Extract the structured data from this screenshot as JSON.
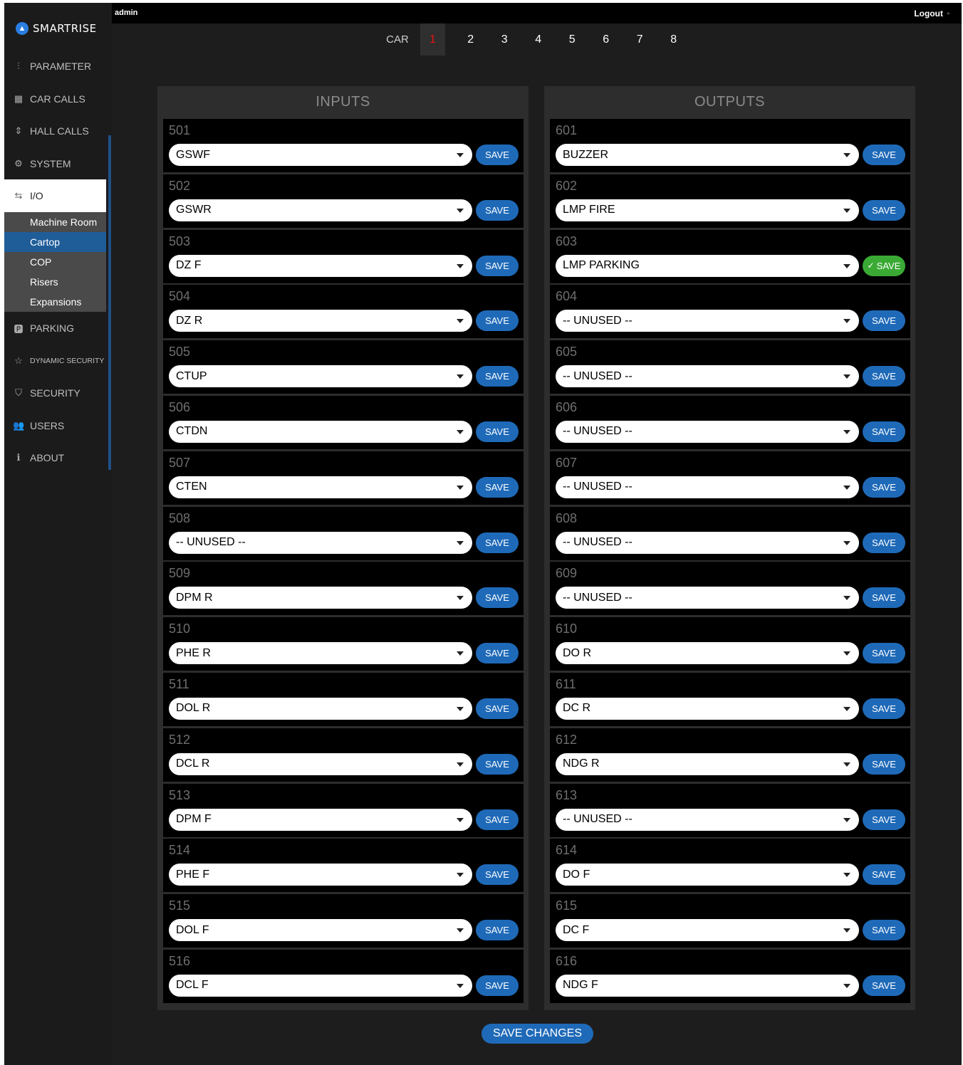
{
  "header": {
    "user": "admin",
    "logout_label": "Logout"
  },
  "brand": {
    "logo_text": "SMARTRISE"
  },
  "sidebar": {
    "items": [
      {
        "label": "PARAMETER",
        "icon": "sliders-icon"
      },
      {
        "label": "CAR CALLS",
        "icon": "keypad-icon"
      },
      {
        "label": "HALL CALLS",
        "icon": "up-down-chevrons-icon"
      },
      {
        "label": "SYSTEM",
        "icon": "gear-icon"
      },
      {
        "label": "I/O",
        "icon": "swap-arrows-icon"
      },
      {
        "label": "PARKING",
        "icon": "parking-icon"
      },
      {
        "label": "DYNAMIC SECURITY",
        "icon": "star-icon"
      },
      {
        "label": "SECURITY",
        "icon": "shield-icon"
      },
      {
        "label": "USERS",
        "icon": "users-icon"
      },
      {
        "label": "ABOUT",
        "icon": "info-icon"
      }
    ],
    "io_subitems": [
      "Machine Room",
      "Cartop",
      "COP",
      "Risers",
      "Expansions"
    ],
    "selected_subitem": "Cartop"
  },
  "car_selector": {
    "label": "CAR",
    "cars": [
      "1",
      "2",
      "3",
      "4",
      "5",
      "6",
      "7",
      "8"
    ],
    "active": "1"
  },
  "inputs": {
    "title": "INPUTS",
    "save_label": "SAVE",
    "rows": [
      {
        "num": "501",
        "value": "GSWF"
      },
      {
        "num": "502",
        "value": "GSWR"
      },
      {
        "num": "503",
        "value": "DZ F"
      },
      {
        "num": "504",
        "value": "DZ R"
      },
      {
        "num": "505",
        "value": "CTUP"
      },
      {
        "num": "506",
        "value": "CTDN"
      },
      {
        "num": "507",
        "value": "CTEN"
      },
      {
        "num": "508",
        "value": "-- UNUSED --"
      },
      {
        "num": "509",
        "value": "DPM R"
      },
      {
        "num": "510",
        "value": "PHE R"
      },
      {
        "num": "511",
        "value": "DOL R"
      },
      {
        "num": "512",
        "value": "DCL R"
      },
      {
        "num": "513",
        "value": "DPM F"
      },
      {
        "num": "514",
        "value": "PHE F"
      },
      {
        "num": "515",
        "value": "DOL F"
      },
      {
        "num": "516",
        "value": "DCL F"
      }
    ]
  },
  "outputs": {
    "title": "OUTPUTS",
    "save_label": "SAVE",
    "rows": [
      {
        "num": "601",
        "value": "BUZZER"
      },
      {
        "num": "602",
        "value": "LMP FIRE"
      },
      {
        "num": "603",
        "value": "LMP PARKING",
        "saved": true
      },
      {
        "num": "604",
        "value": "-- UNUSED --"
      },
      {
        "num": "605",
        "value": "-- UNUSED --"
      },
      {
        "num": "606",
        "value": "-- UNUSED --"
      },
      {
        "num": "607",
        "value": "-- UNUSED --"
      },
      {
        "num": "608",
        "value": "-- UNUSED --"
      },
      {
        "num": "609",
        "value": "-- UNUSED --"
      },
      {
        "num": "610",
        "value": "DO R"
      },
      {
        "num": "611",
        "value": "DC R"
      },
      {
        "num": "612",
        "value": "NDG R"
      },
      {
        "num": "613",
        "value": "-- UNUSED --"
      },
      {
        "num": "614",
        "value": "DO F"
      },
      {
        "num": "615",
        "value": "DC F"
      },
      {
        "num": "616",
        "value": "NDG F"
      }
    ]
  },
  "footer": {
    "save_changes_label": "SAVE CHANGES"
  },
  "colors": {
    "accent": "#1f6ab8",
    "saved": "#3aaa35",
    "active_car": "#e11111",
    "background": "#1d1d1d"
  }
}
